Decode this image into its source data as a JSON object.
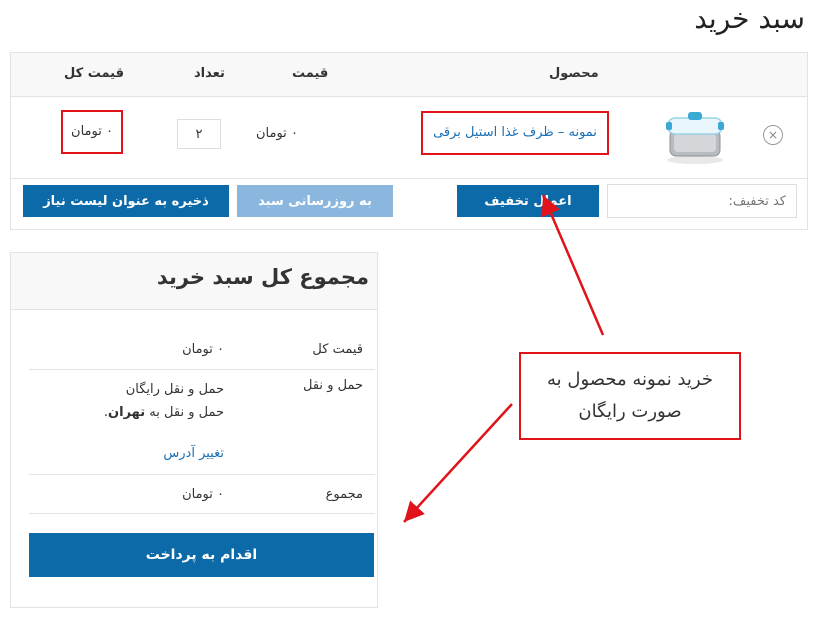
{
  "page": {
    "title": "سبد خرید"
  },
  "cart": {
    "headers": {
      "product": "محصول",
      "price": "قیمت",
      "quantity": "تعداد",
      "subtotal": "قیمت کل"
    },
    "item": {
      "remove_icon": "×",
      "product_name": "نمونه – ظرف غذا استیل برقی",
      "price": "۰ تومان",
      "quantity": "۲",
      "subtotal": "۰ تومان"
    },
    "coupon_placeholder": "کد تخفیف:",
    "apply_coupon_label": "اعمال تخفیف",
    "update_cart_label": "به روزرسانی سبد",
    "save_wishlist_label": "ذخیره به عنوان لیست نیاز"
  },
  "totals": {
    "title": "مجموع کل سبد خرید",
    "subtotal_label": "قیمت کل",
    "subtotal_value": "۰ تومان",
    "shipping_label": "حمل و نقل",
    "shipping_method": "حمل و نقل رایگان",
    "shipping_to_prefix": "حمل و نقل به",
    "shipping_to_city": "تهران",
    "change_address": "تغییر آدرس",
    "total_label": "مجموع",
    "total_value": "۰ تومان",
    "checkout_label": "اقدام به پرداخت"
  },
  "annotation": {
    "text": "خرید نمونه محصول به صورت رایگان",
    "color": "#e0131a"
  },
  "colors": {
    "primary": "#0d6aa9",
    "light_button": "#8bb7de",
    "link": "#1a6fb5",
    "highlight": "#e0131a"
  },
  "icons": {
    "remove": "close-circle-icon",
    "product_thumb": "food-container-icon"
  }
}
